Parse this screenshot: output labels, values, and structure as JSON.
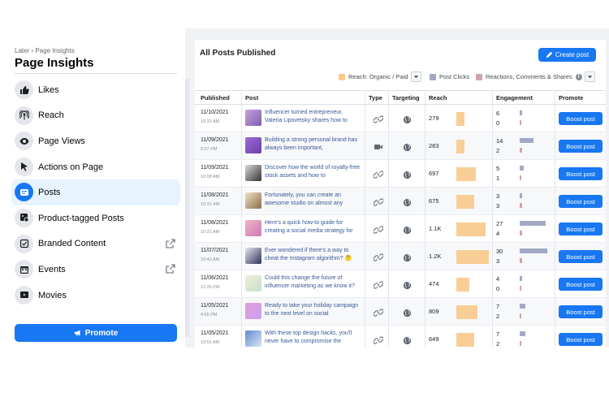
{
  "sidebar": {
    "breadcrumb": "Later › Page Insights",
    "title": "Page Insights",
    "items": [
      {
        "label": "Likes",
        "icon": "thumbs-up-icon"
      },
      {
        "label": "Reach",
        "icon": "broadcast-icon"
      },
      {
        "label": "Page Views",
        "icon": "eye-icon"
      },
      {
        "label": "Actions on Page",
        "icon": "cursor-icon"
      },
      {
        "label": "Posts",
        "icon": "posts-icon",
        "active": true
      },
      {
        "label": "Product-tagged Posts",
        "icon": "tag-icon"
      },
      {
        "label": "Branded Content",
        "icon": "branded-content-icon",
        "external": true
      },
      {
        "label": "Events",
        "icon": "calendar-icon",
        "external": true
      },
      {
        "label": "Movies",
        "icon": "movie-icon"
      }
    ],
    "promote_label": "Promote"
  },
  "main": {
    "card_title": "All Posts Published",
    "create_post_label": "Create post",
    "legend": {
      "reach": "Reach: Organic / Paid",
      "clicks": "Post Clicks",
      "reactions": "Reactions, Comments & Shares"
    },
    "colors": {
      "reach": "#f7c98b",
      "clicks": "#a3a8c6",
      "reactions": "#d0a3ac",
      "accent": "#1877f2"
    },
    "columns": [
      "Published",
      "Post",
      "Type",
      "Targeting",
      "Reach",
      "Engagement",
      "Promote"
    ],
    "rows": [
      {
        "date": "11/10/2021",
        "time": "10:31 AM",
        "text": "Influencer turned entrepreneur, Valeria Lipovetsky shares how to",
        "type": "link-icon",
        "reach": "279",
        "reach_frac": 0.12,
        "eng_a": "6",
        "eng_b": "0",
        "eng_a_frac": 0.1,
        "eng_b_frac": 0,
        "boost": "Boost post"
      },
      {
        "date": "11/09/2021",
        "time": "5:57 PM",
        "text": "Building a strong personal brand has always been important,",
        "type": "video-icon",
        "reach": "283",
        "reach_frac": 0.12,
        "eng_a": "14",
        "eng_b": "2",
        "eng_a_frac": 0.5,
        "eng_b_frac": 0.08,
        "boost": "Boost post"
      },
      {
        "date": "11/09/2021",
        "time": "10:08 AM",
        "text": "Discover how the world of royalty-free stock assets and how to",
        "type": "link-icon",
        "reach": "697",
        "reach_frac": 0.3,
        "eng_a": "5",
        "eng_b": "1",
        "eng_a_frac": 0.15,
        "eng_b_frac": 0.05,
        "boost": "Boost post"
      },
      {
        "date": "11/08/2021",
        "time": "10:31 AM",
        "text": "Fortunately, you can create an awesome studio on almost any",
        "type": "link-icon",
        "reach": "675",
        "reach_frac": 0.28,
        "eng_a": "3",
        "eng_b": "3",
        "eng_a_frac": 0.08,
        "eng_b_frac": 0.08,
        "boost": "Boost post"
      },
      {
        "date": "11/08/2021",
        "time": "10:31 AM",
        "text": "Here's a quick how-to guide for creating a social media strategy for",
        "type": "link-icon",
        "reach": "1.1K",
        "reach_frac": 0.45,
        "eng_a": "27",
        "eng_b": "4",
        "eng_a_frac": 0.95,
        "eng_b_frac": 0.08,
        "boost": "Boost post"
      },
      {
        "date": "11/07/2021",
        "time": "10:42 AM",
        "text": "Ever wondered if there's a way to cheat the Instagram algorithm? 🤔",
        "type": "link-icon",
        "reach": "1.2K",
        "reach_frac": 0.5,
        "eng_a": "30",
        "eng_b": "3",
        "eng_a_frac": 1.0,
        "eng_b_frac": 0.08,
        "boost": "Boost post"
      },
      {
        "date": "11/06/2021",
        "time": "12:26 PM",
        "text": "Could this change the future of influencer marketing as we know it?",
        "type": "link-icon",
        "reach": "474",
        "reach_frac": 0.2,
        "eng_a": "4",
        "eng_b": "0",
        "eng_a_frac": 0.1,
        "eng_b_frac": 0,
        "boost": "Boost post"
      },
      {
        "date": "11/05/2021",
        "time": "4:55 PM",
        "text": "Ready to take your holiday campaign to the next level on social",
        "type": "link-icon",
        "reach": "809",
        "reach_frac": 0.32,
        "eng_a": "7",
        "eng_b": "2",
        "eng_a_frac": 0.2,
        "eng_b_frac": 0.06,
        "boost": "Boost post"
      },
      {
        "date": "11/05/2021",
        "time": "10:51 AM",
        "text": "With these top design hacks, you'll never have to compromise the",
        "type": "link-icon",
        "reach": "649",
        "reach_frac": 0.27,
        "eng_a": "7",
        "eng_b": "2",
        "eng_a_frac": 0.2,
        "eng_b_frac": 0.06,
        "boost": "Boost post"
      }
    ]
  }
}
